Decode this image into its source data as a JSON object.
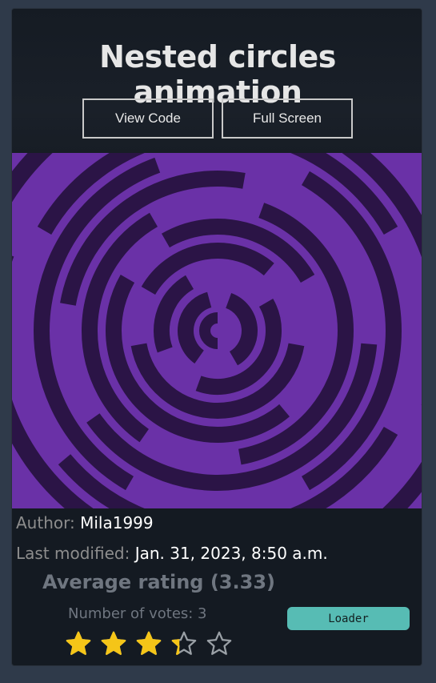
{
  "header": {
    "title": "Nested circles animation",
    "view_code_label": "View Code",
    "full_screen_label": "Full Screen"
  },
  "preview": {
    "colors": {
      "bright": "#6a31a7",
      "dark": "#2b1446"
    }
  },
  "meta": {
    "author_label": "Author:",
    "author_value": "Mila1999",
    "modified_label": "Last modified:",
    "modified_value": "Jan. 31, 2023, 8:50 a.m."
  },
  "rating": {
    "title": "Average rating (3.33)",
    "votes": "Number of votes: 3",
    "value": 3.33,
    "max": 5,
    "star_color": "#f5c518",
    "empty_star_color": "#9aa0a6"
  },
  "tag": {
    "label": "Loader"
  }
}
